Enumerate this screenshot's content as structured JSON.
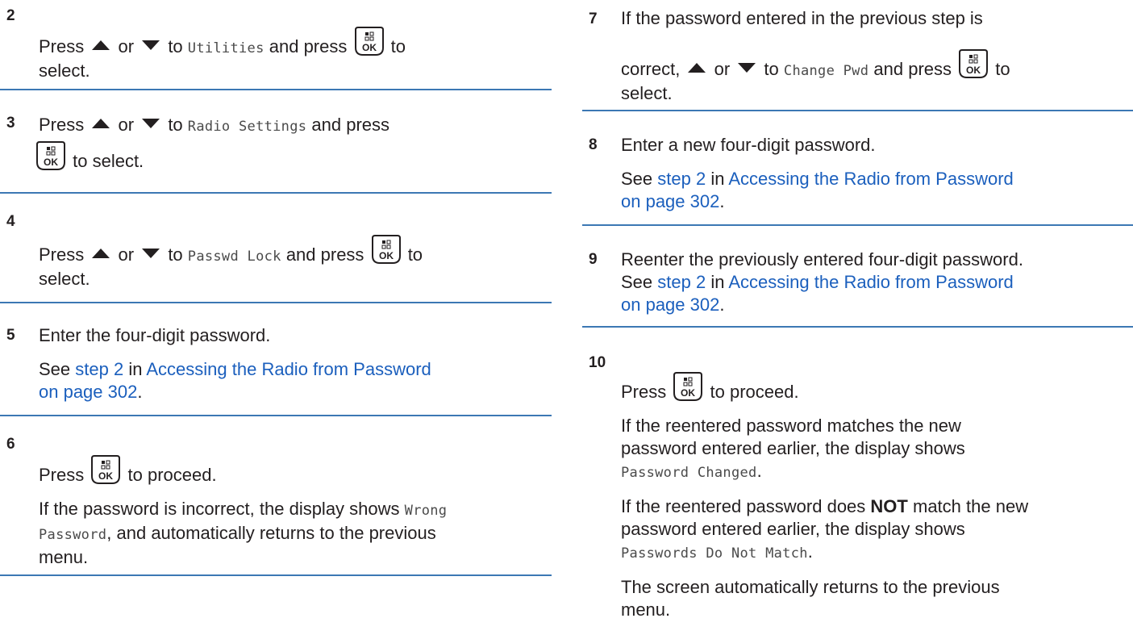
{
  "common": {
    "press": "Press",
    "or": "or",
    "to": "to",
    "and_press": "and press",
    "to_select": "to select.",
    "select": "select.",
    "to_proceed": "to proceed.",
    "see": "See",
    "step2": "step 2",
    "in": "in",
    "link_title": "Accessing the Radio from Password",
    "link_page": "on page 302",
    "period": ".",
    "ok_icon": "ok-button-icon",
    "up_icon": "up-arrow-icon",
    "down_icon": "down-arrow-icon"
  },
  "steps": {
    "s2": {
      "num": "2",
      "menu": "Utilities"
    },
    "s3": {
      "num": "3",
      "menu": "Radio Settings"
    },
    "s4": {
      "num": "4",
      "menu": "Passwd Lock"
    },
    "s5": {
      "num": "5",
      "text": "Enter the four-digit password."
    },
    "s6": {
      "num": "6",
      "body_pre": "If the password is incorrect, the display shows",
      "mono1": "Wrong",
      "mono2": "Password",
      "body_post": ", and automatically returns to the previous",
      "body_end": "menu."
    },
    "s7": {
      "num": "7",
      "line1": "If the password entered in the previous step is",
      "correct": "correct,",
      "menu": "Change Pwd"
    },
    "s8": {
      "num": "8",
      "text": "Enter a new four-digit password."
    },
    "s9": {
      "num": "9",
      "text": "Reenter the previously entered four-digit password."
    },
    "s10": {
      "num": "10",
      "match_line1": "If the reentered password matches the new",
      "match_line2": "password entered earlier, the display shows",
      "match_mono": "Password Changed",
      "nomatch_pre": "If the reentered password does",
      "nomatch_bold": "NOT",
      "nomatch_post": "match the new",
      "nomatch_line2": "password entered earlier, the display shows",
      "nomatch_mono": "Passwords Do Not Match",
      "return_line1": "The screen automatically returns to the previous",
      "return_line2": "menu."
    }
  }
}
